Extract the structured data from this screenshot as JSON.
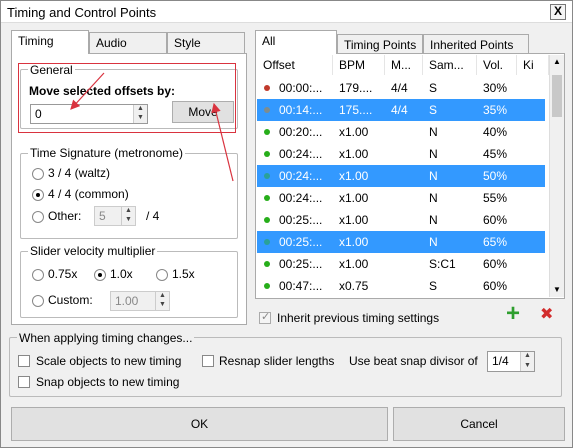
{
  "window": {
    "title": "Timing and Control Points",
    "close_symbol": "X"
  },
  "left_tabs": [
    "Timing",
    "Audio",
    "Style"
  ],
  "general": {
    "group_label": "General",
    "move_label": "Move selected offsets by:",
    "offset_value": "0",
    "move_button": "Move"
  },
  "time_signature": {
    "group_label": "Time Signature (metronome)",
    "options": [
      "3 / 4 (waltz)",
      "4 / 4 (common)",
      "Other:"
    ],
    "selected": "4 / 4 (common)",
    "other_value": "5",
    "other_suffix": "/ 4"
  },
  "slider_velocity": {
    "group_label": "Slider velocity multiplier",
    "options": [
      "0.75x",
      "1.0x",
      "1.5x"
    ],
    "selected": "1.0x",
    "custom_label": "Custom:",
    "custom_value": "1.00"
  },
  "right_tabs": [
    "All",
    "Timing Points",
    "Inherited Points"
  ],
  "table": {
    "columns": [
      "Offset",
      "BPM",
      "M...",
      "Sam...",
      "Vol.",
      "Ki"
    ],
    "rows": [
      {
        "offset": "00:00:...",
        "bpm": "179....",
        "meter": "4/4",
        "sample": "S",
        "volume": "30%",
        "color": "#c0392b",
        "selected": false
      },
      {
        "offset": "00:14:...",
        "bpm": "175....",
        "meter": "4/4",
        "sample": "S",
        "volume": "35%",
        "color": "#7f8c8d",
        "selected": true
      },
      {
        "offset": "00:20:...",
        "bpm": "x1.00",
        "meter": "",
        "sample": "N",
        "volume": "40%",
        "color": "#27ae1a",
        "selected": false
      },
      {
        "offset": "00:24:...",
        "bpm": "x1.00",
        "meter": "",
        "sample": "N",
        "volume": "45%",
        "color": "#27ae1a",
        "selected": false
      },
      {
        "offset": "00:24:...",
        "bpm": "x1.00",
        "meter": "",
        "sample": "N",
        "volume": "50%",
        "color": "#2aa198",
        "selected": true
      },
      {
        "offset": "00:24:...",
        "bpm": "x1.00",
        "meter": "",
        "sample": "N",
        "volume": "55%",
        "color": "#27ae1a",
        "selected": false
      },
      {
        "offset": "00:25:...",
        "bpm": "x1.00",
        "meter": "",
        "sample": "N",
        "volume": "60%",
        "color": "#27ae1a",
        "selected": false
      },
      {
        "offset": "00:25:...",
        "bpm": "x1.00",
        "meter": "",
        "sample": "N",
        "volume": "65%",
        "color": "#2aa198",
        "selected": true
      },
      {
        "offset": "00:25:...",
        "bpm": "x1.00",
        "meter": "",
        "sample": "S:C1",
        "volume": "60%",
        "color": "#27ae1a",
        "selected": false
      },
      {
        "offset": "00:47:...",
        "bpm": "x0.75",
        "meter": "",
        "sample": "S",
        "volume": "60%",
        "color": "#27ae1a",
        "selected": false
      }
    ]
  },
  "inherit_label": "Inherit previous timing settings",
  "add_symbol": "+",
  "remove_symbol": "✖",
  "applying": {
    "group_label": "When applying timing changes...",
    "scale_label": "Scale objects to new timing",
    "resnap_label": "Resnap slider lengths",
    "divisor_label": "Use beat snap divisor of",
    "divisor_value": "1/4",
    "snap_label": "Snap objects to new timing"
  },
  "buttons": {
    "ok": "OK",
    "cancel": "Cancel"
  },
  "colors": {
    "selection": "#3399ff",
    "highlight": "#d9333f",
    "add": "#2e9e2e",
    "remove": "#d22c2c"
  }
}
